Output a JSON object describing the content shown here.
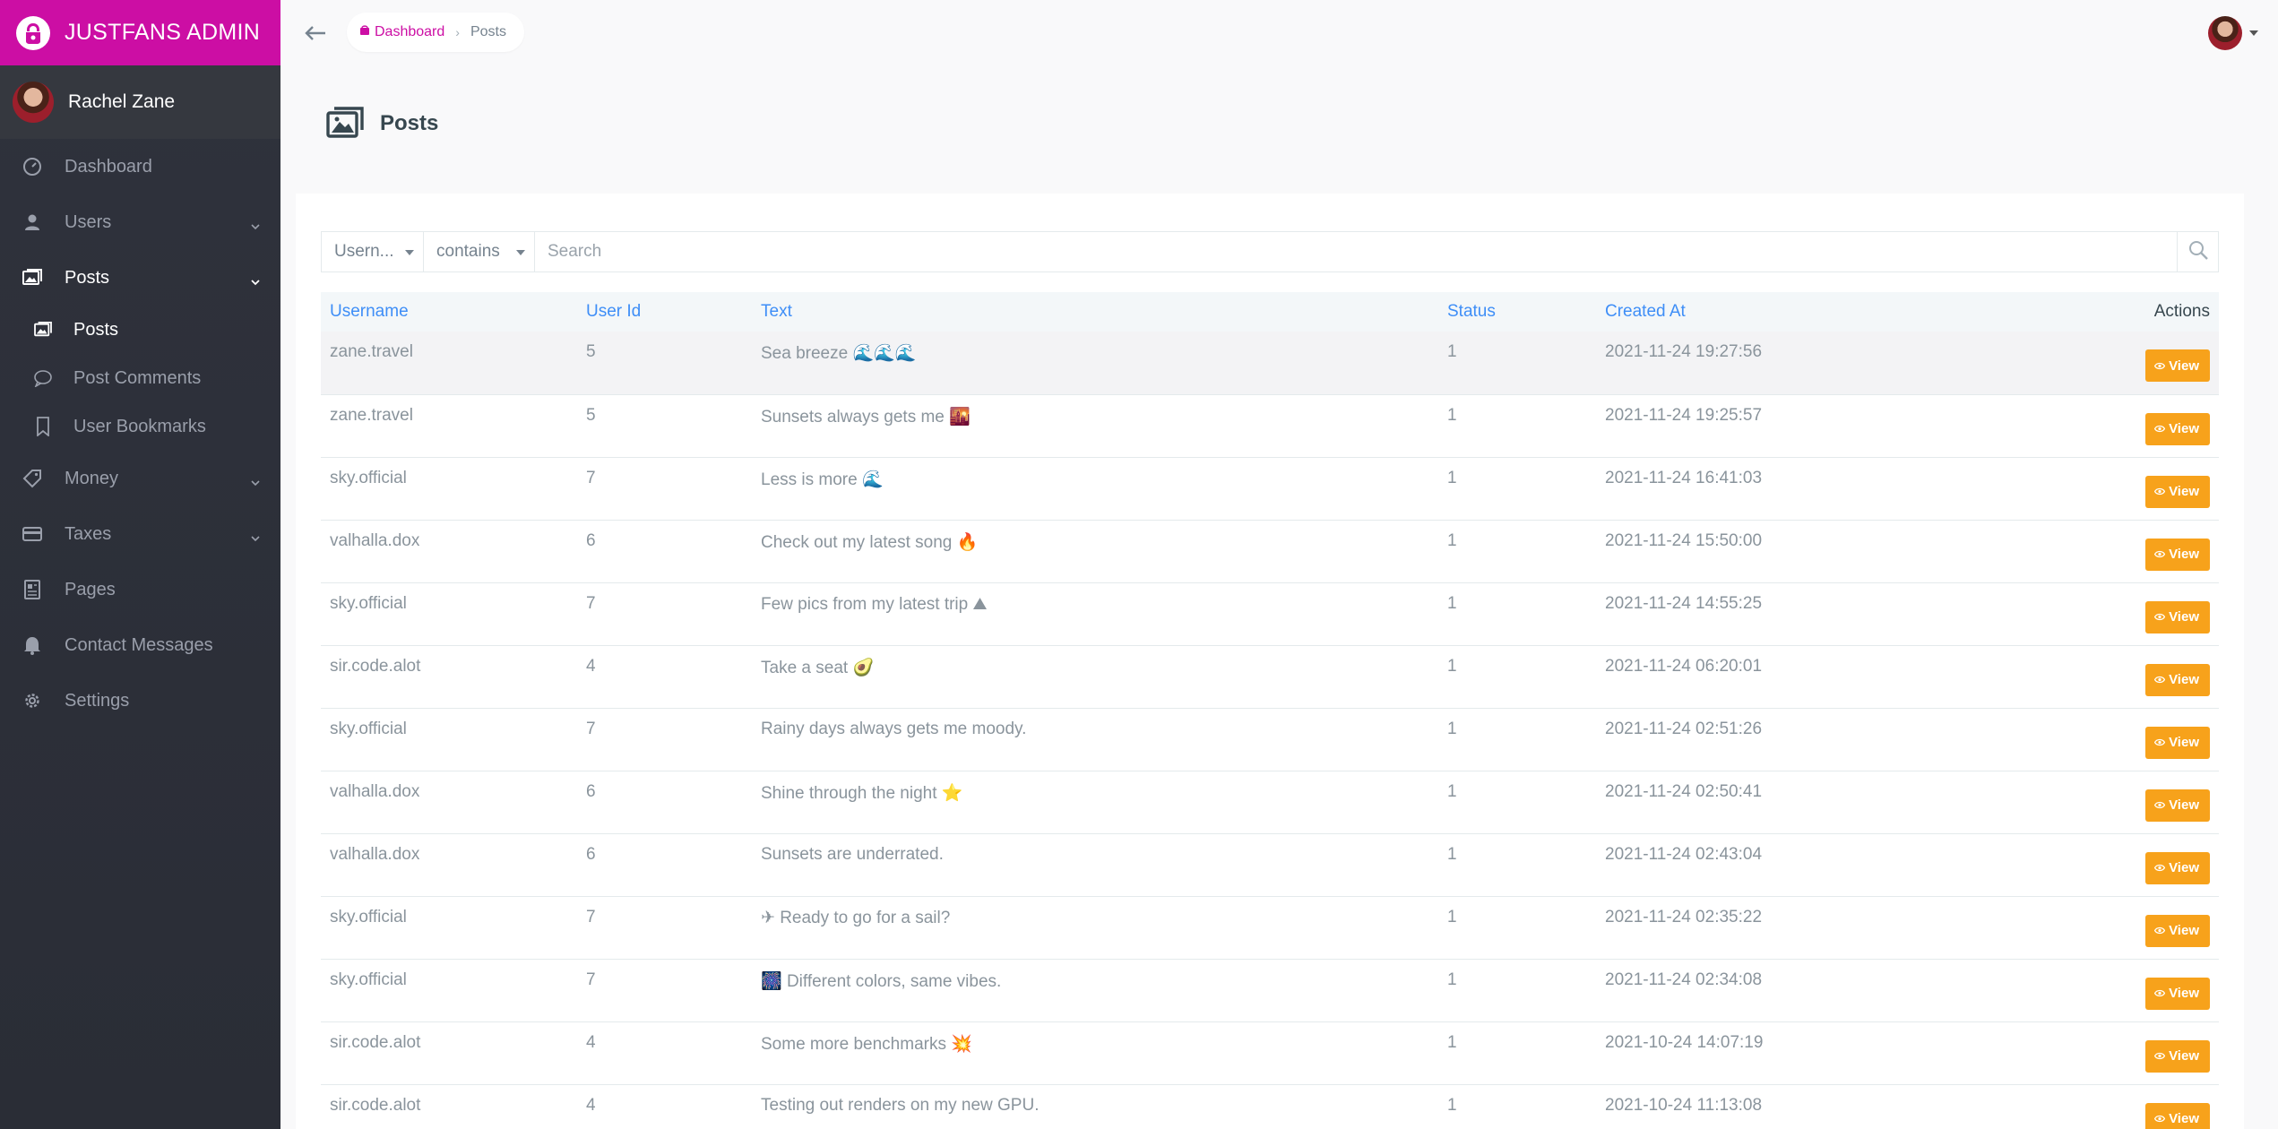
{
  "app": {
    "brand": "JUSTFANS ADMIN"
  },
  "user": {
    "name": "Rachel Zane"
  },
  "sidebar": {
    "items": [
      {
        "label": "Dashboard"
      },
      {
        "label": "Users"
      },
      {
        "label": "Posts"
      },
      {
        "label": "Money"
      },
      {
        "label": "Taxes"
      },
      {
        "label": "Pages"
      },
      {
        "label": "Contact Messages"
      },
      {
        "label": "Settings"
      }
    ],
    "posts_sub": [
      {
        "label": "Posts"
      },
      {
        "label": "Post Comments"
      },
      {
        "label": "User Bookmarks"
      }
    ]
  },
  "breadcrumb": {
    "home": "Dashboard",
    "current": "Posts"
  },
  "page": {
    "title": "Posts"
  },
  "filter": {
    "field": "Usern...",
    "operator": "contains",
    "placeholder": "Search"
  },
  "table": {
    "columns": [
      "Username",
      "User Id",
      "Text",
      "Status",
      "Created At",
      "Actions"
    ],
    "view_label": "View",
    "rows": [
      {
        "username": "zane.travel",
        "user_id": "5",
        "text": "Sea breeze",
        "emoji_after": "🌊🌊🌊",
        "status": "1",
        "created_at": "2021-11-24 19:27:56"
      },
      {
        "username": "zane.travel",
        "user_id": "5",
        "text": "Sunsets always gets me",
        "emoji_after": "🌇",
        "status": "1",
        "created_at": "2021-11-24 19:25:57"
      },
      {
        "username": "sky.official",
        "user_id": "7",
        "text": "Less is more",
        "emoji_after": "🌊",
        "status": "1",
        "created_at": "2021-11-24 16:41:03"
      },
      {
        "username": "valhalla.dox",
        "user_id": "6",
        "text": "Check out my latest song",
        "emoji_after": "🔥",
        "status": "1",
        "created_at": "2021-11-24 15:50:00"
      },
      {
        "username": "sky.official",
        "user_id": "7",
        "text": "Few pics from my latest trip",
        "emoji_after": "⛰",
        "status": "1",
        "created_at": "2021-11-24 14:55:25"
      },
      {
        "username": "sir.code.alot",
        "user_id": "4",
        "text": "Take a seat",
        "emoji_after": "🥑",
        "status": "1",
        "created_at": "2021-11-24 06:20:01"
      },
      {
        "username": "sky.official",
        "user_id": "7",
        "text": "Rainy days always gets me moody.",
        "emoji_after": "",
        "status": "1",
        "created_at": "2021-11-24 02:51:26"
      },
      {
        "username": "valhalla.dox",
        "user_id": "6",
        "text": "Shine through the night",
        "emoji_after": "⭐",
        "status": "1",
        "created_at": "2021-11-24 02:50:41"
      },
      {
        "username": "valhalla.dox",
        "user_id": "6",
        "text": "Sunsets are underrated.",
        "emoji_after": "",
        "status": "1",
        "created_at": "2021-11-24 02:43:04"
      },
      {
        "username": "sky.official",
        "user_id": "7",
        "emoji_before": "✈",
        "text": "Ready to go for a sail?",
        "status": "1",
        "created_at": "2021-11-24 02:35:22"
      },
      {
        "username": "sky.official",
        "user_id": "7",
        "emoji_before": "🎆",
        "text": "Different colors, same vibes.",
        "status": "1",
        "created_at": "2021-11-24 02:34:08"
      },
      {
        "username": "sir.code.alot",
        "user_id": "4",
        "text": "Some more benchmarks",
        "emoji_after": "💥",
        "status": "1",
        "created_at": "2021-10-24 14:07:19"
      },
      {
        "username": "sir.code.alot",
        "user_id": "4",
        "text": "Testing out renders on my new GPU.",
        "emoji_after": "",
        "status": "1",
        "created_at": "2021-10-24 11:13:08"
      }
    ]
  },
  "colors": {
    "brand": "#cc0ea4",
    "sidebar": "#2f323c",
    "view_button": "#f7a21b",
    "link": "#3e8ef7"
  }
}
